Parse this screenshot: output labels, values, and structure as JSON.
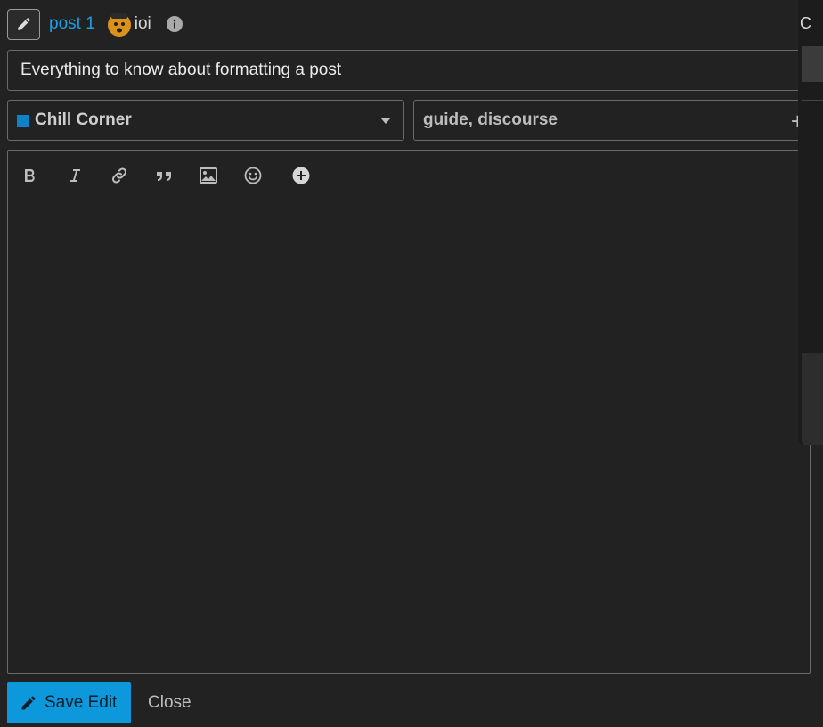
{
  "header": {
    "post_link": "post 1",
    "username": "ioi",
    "icons": {
      "edit_mode": "pencil-icon",
      "avatar": "user-avatar",
      "info": "info-icon"
    }
  },
  "title": {
    "value": "Everything to know about formatting a post"
  },
  "category": {
    "name": "Chill Corner",
    "color": "#0f82c7"
  },
  "tags": {
    "value": "guide, discourse",
    "add_label": "+"
  },
  "toolbar": {
    "buttons": [
      "bold-icon",
      "italic-icon",
      "link-icon",
      "quote-icon",
      "image-icon",
      "emoji-icon",
      "add-icon"
    ]
  },
  "side_panel": {
    "visible_text": "C"
  },
  "footer": {
    "save_label": "Save Edit",
    "close_label": "Close"
  },
  "colors": {
    "accent": "#0d98dc",
    "link": "#1e9ee3",
    "background": "#222222"
  }
}
